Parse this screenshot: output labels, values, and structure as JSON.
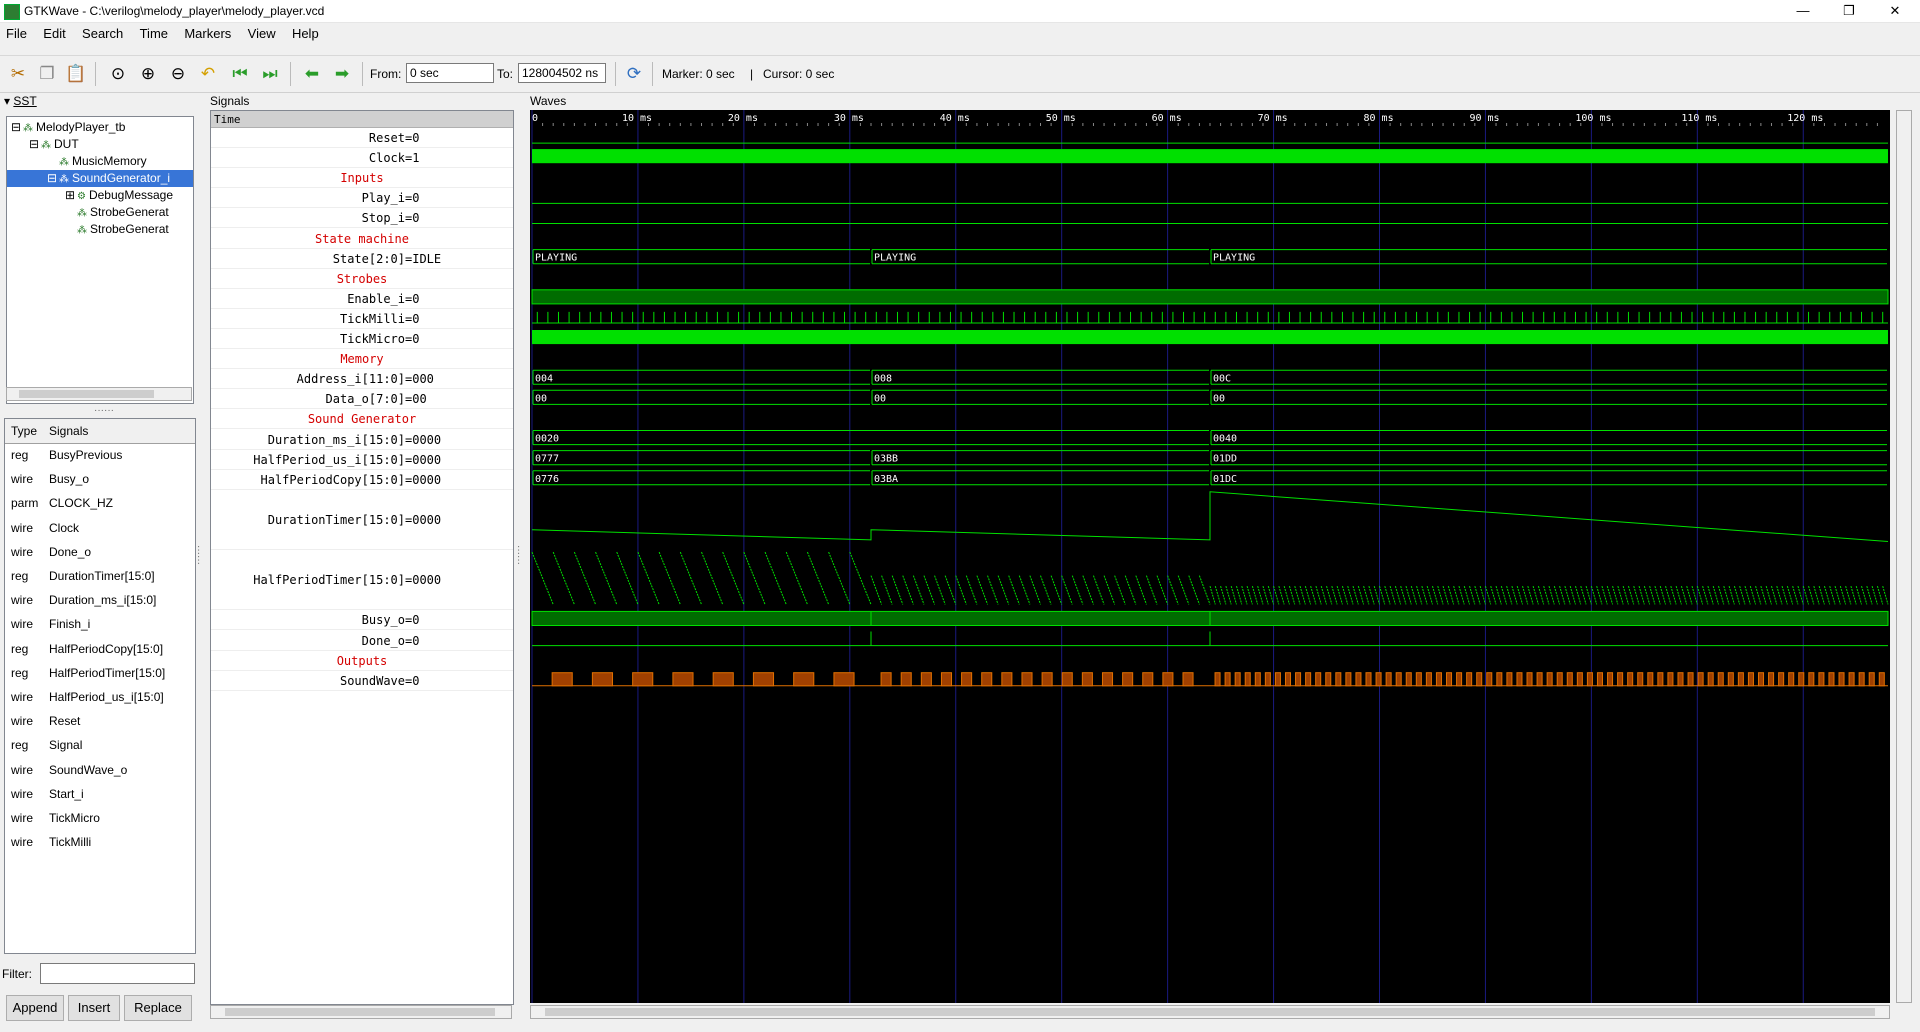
{
  "window": {
    "title": "GTKWave - C:\\verilog\\melody_player\\melody_player.vcd",
    "minimize": "—",
    "maximize": "❐",
    "close": "✕"
  },
  "menu": [
    "File",
    "Edit",
    "Search",
    "Time",
    "Markers",
    "View",
    "Help"
  ],
  "toolbar": {
    "from_label": "From:",
    "from_value": "0 sec",
    "to_label": "To:",
    "to_value": "128004502 ns",
    "marker": "Marker: 0 sec",
    "separator": "|",
    "cursor": "Cursor: 0 sec",
    "icons": [
      "cut-icon",
      "copy-icon",
      "paste-icon",
      "zoom-fit-icon",
      "zoom-in-icon",
      "zoom-out-icon",
      "undo-icon",
      "first-icon",
      "last-icon",
      "left-icon",
      "right-icon",
      "reload-icon"
    ]
  },
  "sst": {
    "title": "SST",
    "tree": [
      {
        "label": "MelodyPlayer_tb",
        "level": 0,
        "expander": "⊟"
      },
      {
        "label": "DUT",
        "level": 1,
        "expander": "⊟"
      },
      {
        "label": "MusicMemory",
        "level": 2,
        "expander": ""
      },
      {
        "label": "SoundGenerator_i",
        "level": 2,
        "expander": "⊟",
        "selected": true
      },
      {
        "label": "DebugMessage",
        "level": 3,
        "expander": "⊞"
      },
      {
        "label": "StrobeGenerat",
        "level": 3,
        "expander": ""
      },
      {
        "label": "StrobeGenerat",
        "level": 3,
        "expander": ""
      }
    ],
    "type_header": "Type",
    "signals_header": "Signals",
    "signals": [
      {
        "type": "reg",
        "name": "BusyPrevious"
      },
      {
        "type": "wire",
        "name": "Busy_o"
      },
      {
        "type": "parm",
        "name": "CLOCK_HZ"
      },
      {
        "type": "wire",
        "name": "Clock"
      },
      {
        "type": "wire",
        "name": "Done_o"
      },
      {
        "type": "reg",
        "name": "DurationTimer[15:0]"
      },
      {
        "type": "wire",
        "name": "Duration_ms_i[15:0]"
      },
      {
        "type": "wire",
        "name": "Finish_i"
      },
      {
        "type": "reg",
        "name": "HalfPeriodCopy[15:0]"
      },
      {
        "type": "reg",
        "name": "HalfPeriodTimer[15:0]"
      },
      {
        "type": "wire",
        "name": "HalfPeriod_us_i[15:0]"
      },
      {
        "type": "wire",
        "name": "Reset"
      },
      {
        "type": "reg",
        "name": "Signal"
      },
      {
        "type": "wire",
        "name": "SoundWave_o"
      },
      {
        "type": "wire",
        "name": "Start_i"
      },
      {
        "type": "wire",
        "name": "TickMicro"
      },
      {
        "type": "wire",
        "name": "TickMilli"
      }
    ],
    "filter_label": "Filter:",
    "buttons": {
      "append": "Append",
      "insert": "Insert",
      "replace": "Replace"
    }
  },
  "signals_panel": {
    "title": "Signals",
    "time_label": "Time",
    "rows": [
      {
        "name": "Reset",
        "value": "=0",
        "kind": "sig",
        "h": 1
      },
      {
        "name": "Clock",
        "value": "=1",
        "kind": "sig",
        "h": 1
      },
      {
        "name": "Inputs",
        "value": "",
        "kind": "grp",
        "h": 1
      },
      {
        "name": "Play_i",
        "value": "=0",
        "kind": "sig",
        "h": 1
      },
      {
        "name": "Stop_i",
        "value": "=0",
        "kind": "sig",
        "h": 1
      },
      {
        "name": "State machine",
        "value": "",
        "kind": "grp",
        "h": 1
      },
      {
        "name": "State[2:0]",
        "value": "=IDLE",
        "kind": "sig",
        "h": 1
      },
      {
        "name": "Strobes",
        "value": "",
        "kind": "grp",
        "h": 1
      },
      {
        "name": "Enable_i",
        "value": "=0",
        "kind": "sig",
        "h": 1
      },
      {
        "name": "TickMilli",
        "value": "=0",
        "kind": "sig",
        "h": 1
      },
      {
        "name": "TickMicro",
        "value": "=0",
        "kind": "sig",
        "h": 1
      },
      {
        "name": "Memory",
        "value": "",
        "kind": "grp",
        "h": 1
      },
      {
        "name": "Address_i[11:0]",
        "value": "=000",
        "kind": "sig",
        "h": 1
      },
      {
        "name": "Data_o[7:0]",
        "value": "=00",
        "kind": "sig",
        "h": 1
      },
      {
        "name": "Sound Generator",
        "value": "",
        "kind": "grp",
        "h": 1
      },
      {
        "name": "Duration_ms_i[15:0]",
        "value": "=0000",
        "kind": "sig",
        "h": 1
      },
      {
        "name": "HalfPeriod_us_i[15:0]",
        "value": "=0000",
        "kind": "sig",
        "h": 1
      },
      {
        "name": "HalfPeriodCopy[15:0]",
        "value": "=0000",
        "kind": "sig",
        "h": 1
      },
      {
        "name": "DurationTimer[15:0]",
        "value": "=0000",
        "kind": "sig",
        "h": 3
      },
      {
        "name": "HalfPeriodTimer[15:0]",
        "value": "=0000",
        "kind": "sig",
        "h": 3
      },
      {
        "name": "Busy_o",
        "value": "=0",
        "kind": "sig",
        "h": 1
      },
      {
        "name": "Done_o",
        "value": "=0",
        "kind": "sig",
        "h": 1
      },
      {
        "name": "Outputs",
        "value": "",
        "kind": "grp",
        "h": 1
      },
      {
        "name": "SoundWave",
        "value": "=0",
        "kind": "sig",
        "h": 1
      }
    ]
  },
  "waves_panel": {
    "title": "Waves",
    "time_range_ms": [
      0,
      128
    ],
    "ticks": [
      "0",
      "10 ms",
      "20 ms",
      "30 ms",
      "40 ms",
      "50 ms",
      "60 ms",
      "70 ms",
      "80 ms",
      "90 ms",
      "100 ms",
      "110 ms",
      "120 ms"
    ],
    "segments_ms": [
      0,
      32,
      64
    ],
    "bus_values": {
      "State[2:0]": [
        "PLAYING",
        "PLAYING",
        "PLAYING"
      ],
      "Address_i[11:0]": [
        "004",
        "008",
        "00C"
      ],
      "Data_o[7:0]": [
        "00",
        "00",
        "00"
      ],
      "Duration_ms_i[15:0]": [
        "0020",
        "",
        "0040"
      ],
      "HalfPeriod_us_i[15:0]": [
        "0777",
        "03BB",
        "01DD"
      ],
      "HalfPeriodCopy[15:0]": [
        "0776",
        "03BA",
        "01DC"
      ]
    },
    "colors": {
      "wave": "#00e000",
      "wave_fill": "#006c00",
      "grid": "#1a1a80",
      "sound": "#e07000",
      "group_text": "#d40000"
    }
  }
}
